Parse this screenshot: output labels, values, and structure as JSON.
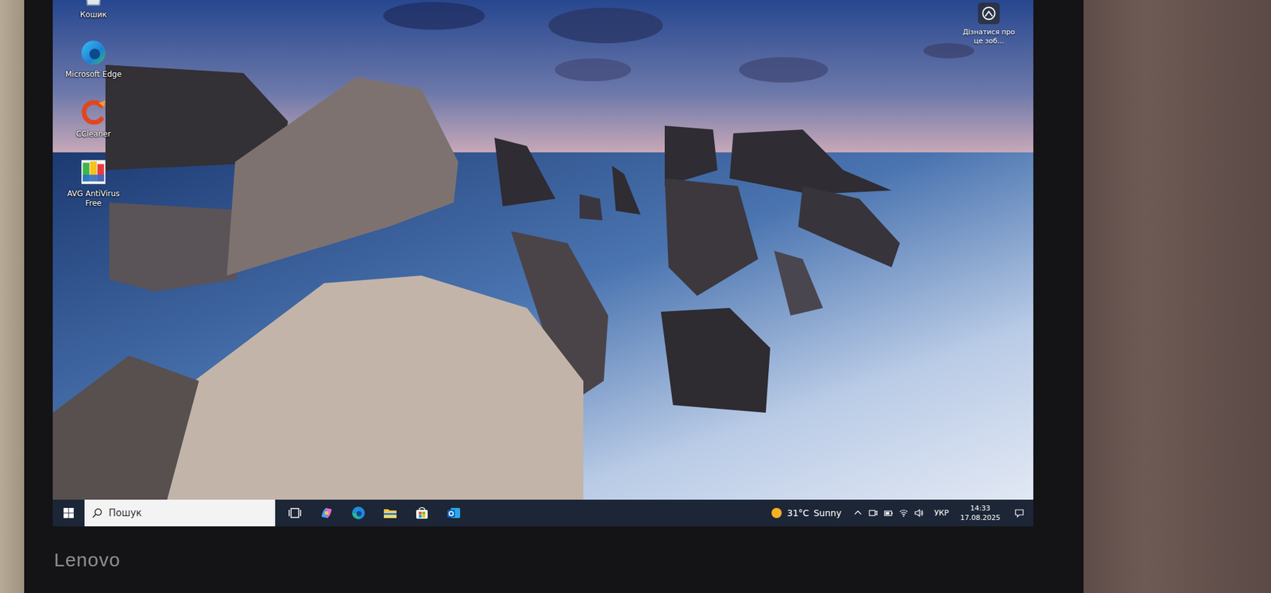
{
  "desktop": {
    "icons": [
      {
        "label": "Кошик",
        "kind": "recycle-bin"
      },
      {
        "label": "Microsoft Edge",
        "kind": "edge"
      },
      {
        "label": "CCleaner",
        "kind": "ccleaner"
      },
      {
        "label": "AVG AntiVirus Free",
        "kind": "avg"
      }
    ],
    "spotlight": {
      "label": "Дізнатися про це зоб..."
    }
  },
  "taskbar": {
    "search": {
      "placeholder": "Пошук"
    },
    "weather": {
      "temperature": "31°C",
      "condition": "Sunny"
    },
    "language": "УКР",
    "clock": {
      "time": "14:33",
      "date": "17.08.2025"
    }
  },
  "laptop": {
    "brand": "Lenovo"
  }
}
